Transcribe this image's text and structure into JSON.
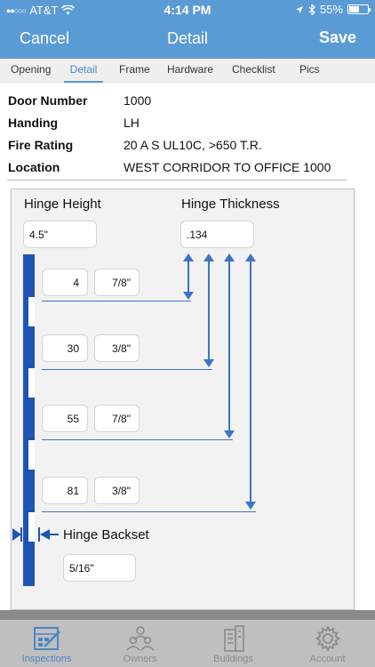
{
  "status_bar": {
    "carrier": "AT&T",
    "time": "4:14 PM",
    "battery": "55%",
    "battery_level": 0.55
  },
  "nav": {
    "cancel": "Cancel",
    "title": "Detail",
    "save": "Save"
  },
  "tabs": [
    {
      "label": "Opening",
      "active": false
    },
    {
      "label": "Detail",
      "active": true
    },
    {
      "label": "Frame",
      "active": false
    },
    {
      "label": "Hardware",
      "active": false
    },
    {
      "label": "Checklist",
      "active": false
    },
    {
      "label": "Pics",
      "active": false
    }
  ],
  "details": [
    {
      "label": "Door Number",
      "value": "1000"
    },
    {
      "label": "Handing",
      "value": "LH"
    },
    {
      "label": "Fire Rating",
      "value": "20 A S UL10C, >650 T.R."
    },
    {
      "label": "Location",
      "value": "WEST CORRIDOR TO OFFICE 1000"
    }
  ],
  "diagram": {
    "hinge_height_label": "Hinge Height",
    "hinge_height_value": "4.5\"",
    "hinge_thickness_label": "Hinge Thickness",
    "hinge_thickness_value": ".134",
    "hinges": [
      {
        "whole": "4",
        "fraction": "7/8\""
      },
      {
        "whole": "30",
        "fraction": "3/8\""
      },
      {
        "whole": "55",
        "fraction": "7/8\""
      },
      {
        "whole": "81",
        "fraction": "3/8\""
      }
    ],
    "backset_label": "Hinge Backset",
    "backset_value": "5/16\""
  },
  "bottom_tabs": [
    {
      "label": "Inspections",
      "icon": "inspections-icon",
      "active": true
    },
    {
      "label": "Owners",
      "icon": "owners-icon",
      "active": false
    },
    {
      "label": "Buildings",
      "icon": "buildings-icon",
      "active": false
    },
    {
      "label": "Account",
      "icon": "gear-icon",
      "active": false
    }
  ],
  "colors": {
    "accent": "#5b9bd5",
    "door": "#1f54b5",
    "arrow": "#3c74c8"
  }
}
